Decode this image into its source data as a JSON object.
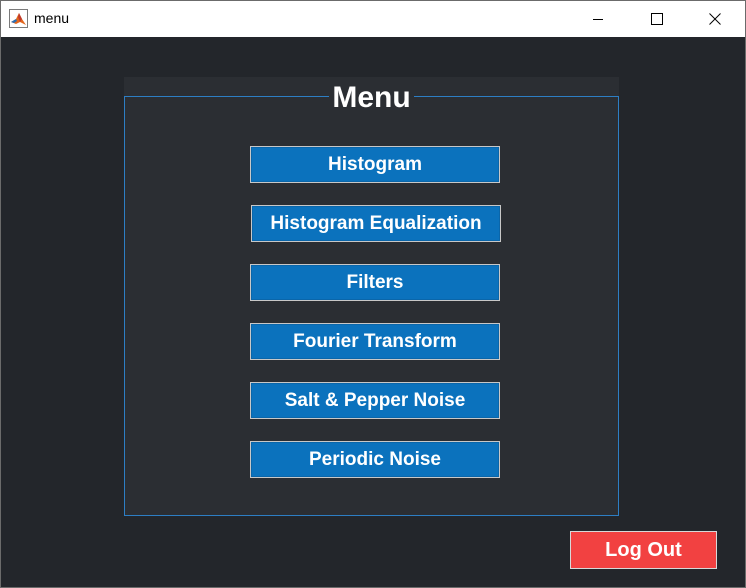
{
  "window": {
    "title": "menu",
    "app_icon": "matlab-icon"
  },
  "panel": {
    "title": "Menu"
  },
  "menu_buttons": [
    {
      "label": "Histogram"
    },
    {
      "label": "Histogram Equalization"
    },
    {
      "label": "Filters"
    },
    {
      "label": "Fourier Transform"
    },
    {
      "label": "Salt & Pepper Noise"
    },
    {
      "label": "Periodic Noise"
    }
  ],
  "logout": {
    "label": "Log Out"
  },
  "colors": {
    "background": "#23262b",
    "panel": "#2b2e33",
    "panel_border": "#2d7ec4",
    "button": "#0b72bd",
    "logout_button": "#f24141",
    "text": "#ffffff"
  }
}
